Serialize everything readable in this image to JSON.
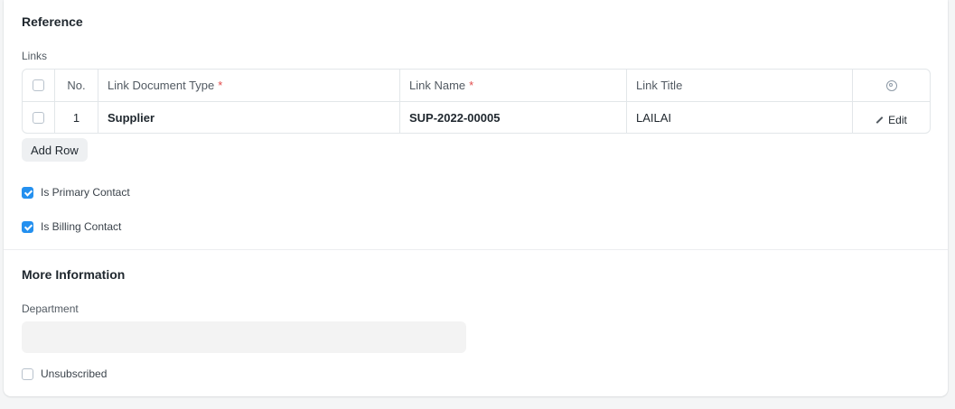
{
  "reference": {
    "title": "Reference",
    "links_label": "Links",
    "table": {
      "headers": {
        "no": "No.",
        "link_document_type": "Link Document Type",
        "link_name": "Link Name",
        "link_title": "Link Title",
        "required_mark": "*"
      },
      "rows": [
        {
          "no": "1",
          "link_document_type": "Supplier",
          "link_name": "SUP-2022-00005",
          "link_title": "LAILAI",
          "action_label": "Edit"
        }
      ]
    },
    "add_row_label": "Add Row",
    "is_primary_contact": {
      "label": "Is Primary Contact",
      "checked": true
    },
    "is_billing_contact": {
      "label": "Is Billing Contact",
      "checked": true
    }
  },
  "more_information": {
    "title": "More Information",
    "department": {
      "label": "Department",
      "value": "",
      "placeholder": ""
    },
    "unsubscribed": {
      "label": "Unsubscribed",
      "checked": false
    }
  },
  "colors": {
    "accent": "#2490ef",
    "required": "#e24c4c"
  },
  "icons": {
    "settings": "gear-icon",
    "edit": "pencil-icon"
  }
}
